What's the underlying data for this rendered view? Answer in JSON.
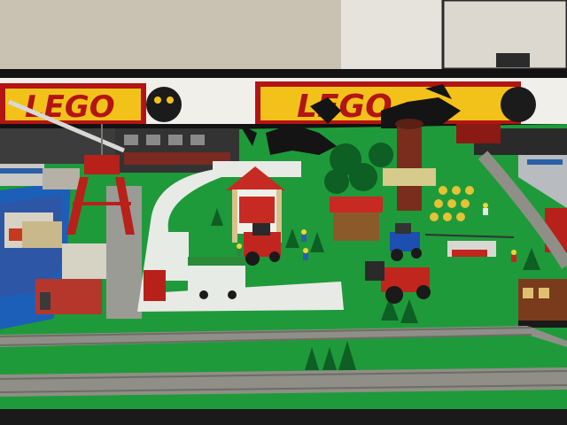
{
  "scene": {
    "description_free": true,
    "banners": {
      "left_text": "LEGO",
      "right_text": "LEGO"
    },
    "colors": {
      "floor": "#c9c2b2",
      "wall": "#e9e6df",
      "baseplate_green": "#1f9a3a",
      "baseplate_dark": "#16792c",
      "water_blue": "#1b5fb8",
      "road_white": "#e8eae6",
      "track": "#8f8f87",
      "banner_red": "#b31414",
      "banner_yellow": "#f2c21a",
      "barn_red": "#c62a22",
      "tractor_red": "#c1261e",
      "crane_red": "#b8201a",
      "tree_green": "#0d5f24",
      "tarp_gray": "#3a3a3a"
    }
  }
}
